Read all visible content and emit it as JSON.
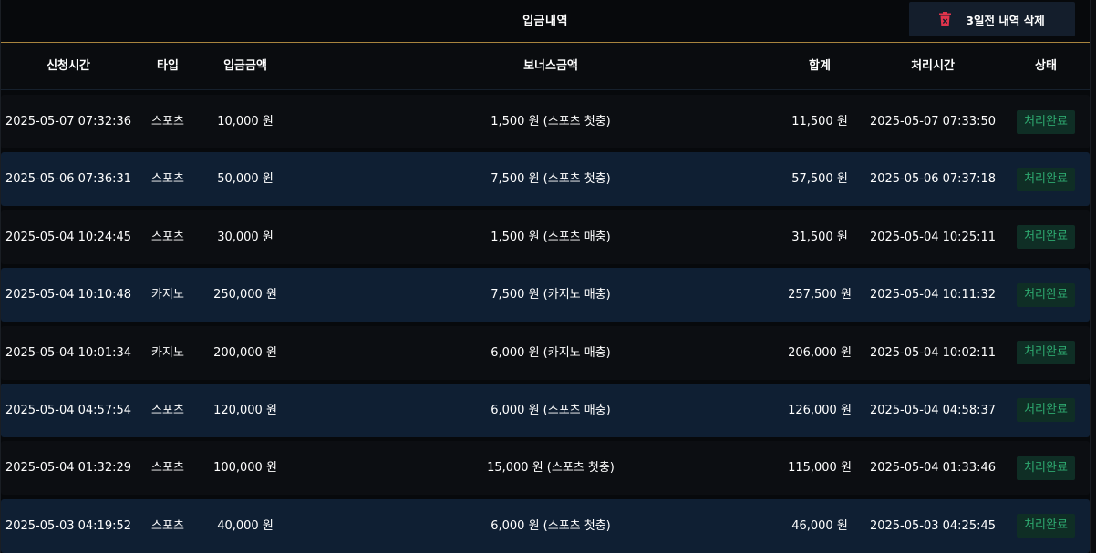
{
  "header": {
    "title": "입금내역",
    "delete_label": "3일전 내역 삭제"
  },
  "columns": [
    "신청시간",
    "타입",
    "입금금액",
    "보너스금액",
    "합계",
    "처리시간",
    "상태"
  ],
  "rows": [
    {
      "time": "2025-05-07 07:32:36",
      "type": "스포츠",
      "amount": "10,000 원",
      "bonus": "1,500 원 (스포츠 첫충)",
      "total": "11,500 원",
      "processed": "2025-05-07 07:33:50",
      "status": "처리완료"
    },
    {
      "time": "2025-05-06 07:36:31",
      "type": "스포츠",
      "amount": "50,000 원",
      "bonus": "7,500 원 (스포츠 첫충)",
      "total": "57,500 원",
      "processed": "2025-05-06 07:37:18",
      "status": "처리완료"
    },
    {
      "time": "2025-05-04 10:24:45",
      "type": "스포츠",
      "amount": "30,000 원",
      "bonus": "1,500 원 (스포츠 매충)",
      "total": "31,500 원",
      "processed": "2025-05-04 10:25:11",
      "status": "처리완료"
    },
    {
      "time": "2025-05-04 10:10:48",
      "type": "카지노",
      "amount": "250,000 원",
      "bonus": "7,500 원 (카지노 매충)",
      "total": "257,500 원",
      "processed": "2025-05-04 10:11:32",
      "status": "처리완료"
    },
    {
      "time": "2025-05-04 10:01:34",
      "type": "카지노",
      "amount": "200,000 원",
      "bonus": "6,000 원 (카지노 매충)",
      "total": "206,000 원",
      "processed": "2025-05-04 10:02:11",
      "status": "처리완료"
    },
    {
      "time": "2025-05-04 04:57:54",
      "type": "스포츠",
      "amount": "120,000 원",
      "bonus": "6,000 원 (스포츠 매충)",
      "total": "126,000 원",
      "processed": "2025-05-04 04:58:37",
      "status": "처리완료"
    },
    {
      "time": "2025-05-04 01:32:29",
      "type": "스포츠",
      "amount": "100,000 원",
      "bonus": "15,000 원 (스포츠 첫충)",
      "total": "115,000 원",
      "processed": "2025-05-04 01:33:46",
      "status": "처리완료"
    },
    {
      "time": "2025-05-03 04:19:52",
      "type": "스포츠",
      "amount": "40,000 원",
      "bonus": "6,000 원 (스포츠 첫충)",
      "total": "46,000 원",
      "processed": "2025-05-03 04:25:45",
      "status": "처리완료"
    }
  ],
  "colors": {
    "accent_line": "#a8843e",
    "row_dark": "#0c0e12",
    "row_blue": "#0f1f33",
    "status_text": "#2ea86f",
    "status_bg": "#0f2e25",
    "trash_icon": "#e0344c"
  },
  "icons": {
    "delete": "trash-icon"
  }
}
